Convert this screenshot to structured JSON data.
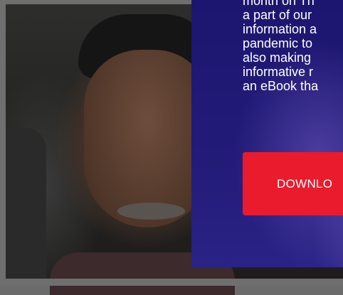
{
  "panel": {
    "text_lines": [
      "month on Th",
      "a part of our",
      "information a",
      "pandemic to",
      "also making",
      "informative r",
      "an eBook tha"
    ],
    "download_label": "DOWNLO"
  },
  "colors": {
    "panel_background": "#1d1670",
    "button_background": "#ea1b2d",
    "text": "#ffffff"
  }
}
